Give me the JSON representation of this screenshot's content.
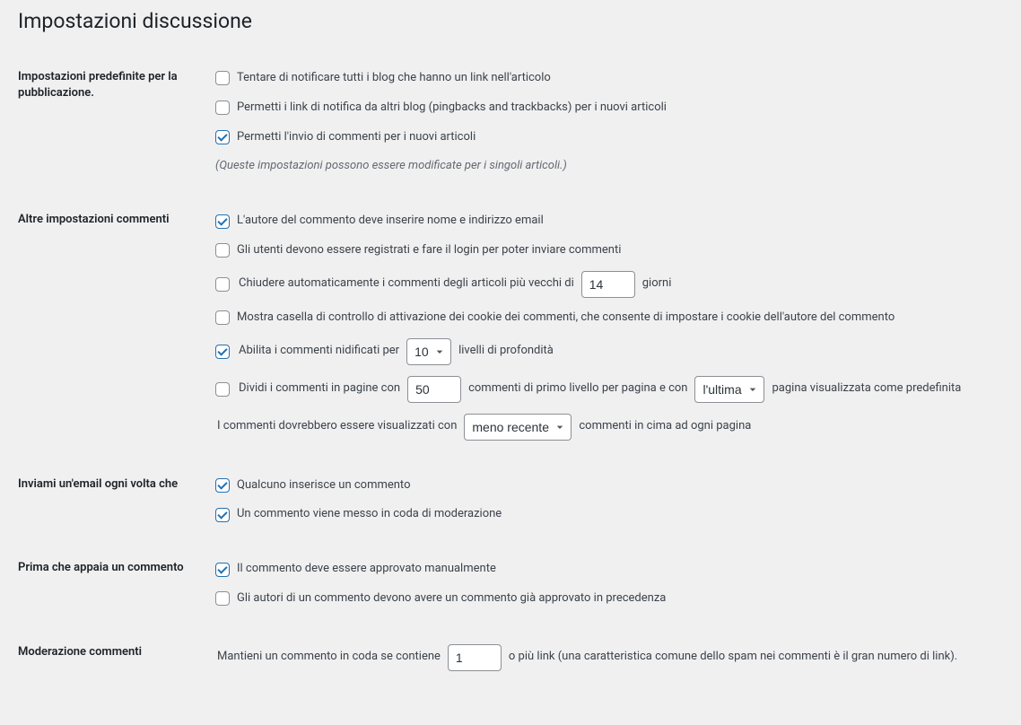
{
  "page_title": "Impostazioni discussione",
  "sections": {
    "defaults": {
      "heading": "Impostazioni predefinite per la pubblicazione.",
      "options": {
        "notify_blogs": "Tentare di notificare tutti i blog che hanno un link nell'articolo",
        "allow_pingbacks": "Permetti i link di notifica da altri blog (pingbacks and trackbacks) per i nuovi articoli",
        "allow_comments": "Permetti l'invio di commenti per i nuovi articoli"
      },
      "note": "(Queste impostazioni possono essere modificate per i singoli articoli.)"
    },
    "other_comments": {
      "heading": "Altre impostazioni commenti",
      "options": {
        "require_name_email": "L'autore del commento deve inserire nome e indirizzo email",
        "require_registered": "Gli utenti devono essere registrati e fare il login per poter inviare commenti",
        "auto_close_pre": "Chiudere automaticamente i commenti degli articoli più vecchi di",
        "auto_close_days": "14",
        "auto_close_post": "giorni",
        "cookie_consent": "Mostra casella di controllo di attivazione dei cookie dei commenti, che consente di impostare i cookie dell'autore del commento",
        "nested_pre": "Abilita i commenti nidificati per",
        "nested_levels": "10",
        "nested_post": "livelli di profondità",
        "paginate_pre": "Dividi i commenti in pagine con",
        "paginate_perpage": "50",
        "paginate_mid": "commenti di primo livello per pagina e con",
        "paginate_page": "l'ultima",
        "paginate_post": "pagina visualizzata come predefinita",
        "order_pre": "I commenti dovrebbero essere visualizzati con",
        "order_value": "meno recente",
        "order_post": "commenti in cima ad ogni pagina"
      }
    },
    "email_me": {
      "heading": "Inviami un'email ogni volta che",
      "options": {
        "someone_posts": "Qualcuno inserisce un commento",
        "held_moderation": "Un commento viene messo in coda di moderazione"
      }
    },
    "before_appears": {
      "heading": "Prima che appaia un commento",
      "options": {
        "manual_approval": "Il commento deve essere approvato manualmente",
        "prev_approved": "Gli autori di un commento devono avere un commento già approvato in precedenza"
      }
    },
    "moderation": {
      "heading": "Moderazione commenti",
      "hold_pre": "Mantieni un commento in coda se contiene",
      "hold_links": "1",
      "hold_post": "o più link (una caratteristica comune dello spam nei commenti è il gran numero di link)."
    }
  }
}
